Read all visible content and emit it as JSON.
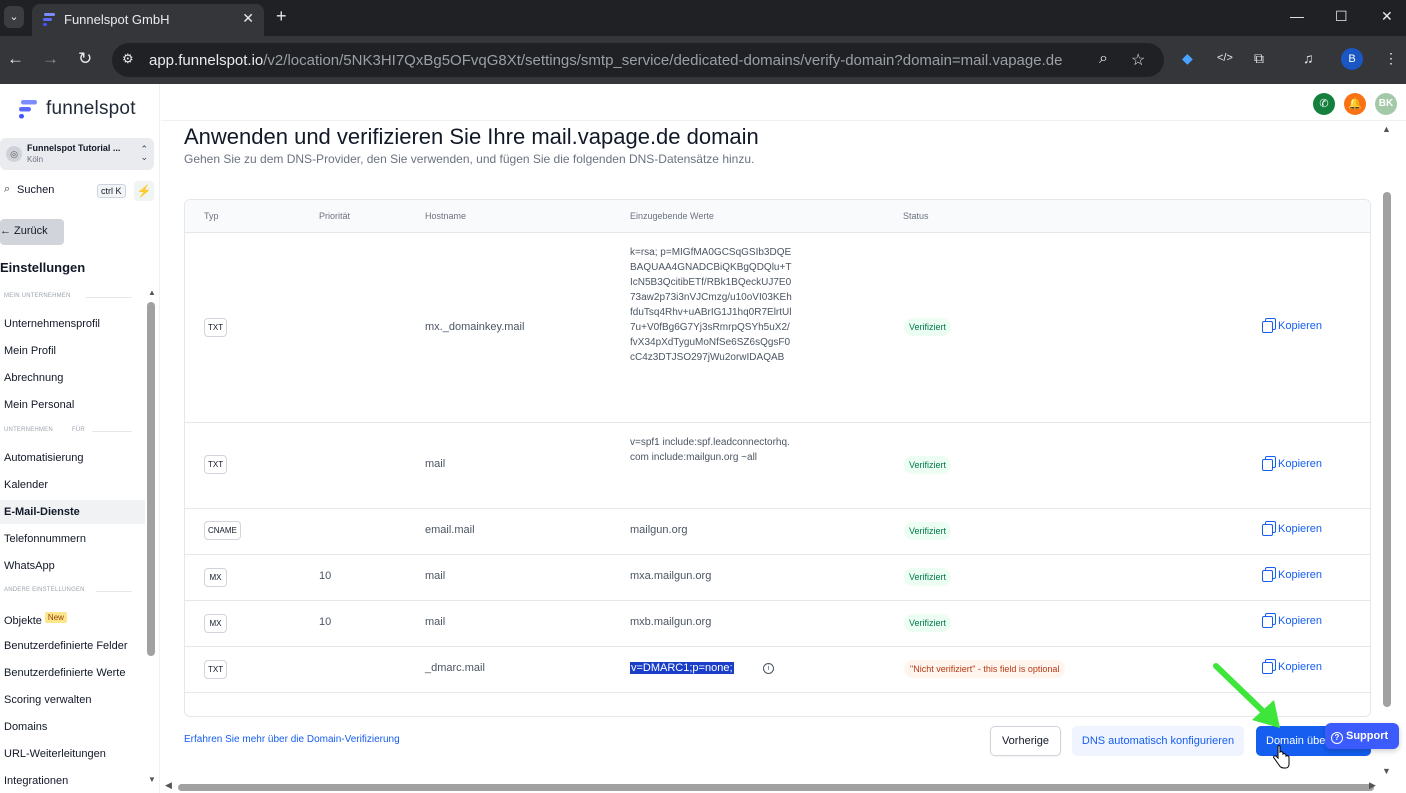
{
  "browser": {
    "tab_title": "Funnelspot GmbH",
    "url_host": "app.funnelspot.io",
    "url_path": "/v2/location/5NK3HI7QxBg5OFvqG8Xt/settings/smtp_service/dedicated-domains/verify-domain?domain=mail.vapage.de",
    "profile_initial": "B"
  },
  "sidebar": {
    "logo_text": "funnelspot",
    "location_name": "Funnelspot Tutorial ...",
    "location_city": "Köln",
    "search_label": "Suchen",
    "search_shortcut": "ctrl K",
    "back_label": "← Zurück",
    "section_title": "Einstellungen",
    "group1": "MEIN UNTERNEHMEN",
    "group2_a": "UNTERNEHMEN",
    "group2_b": "FÜR",
    "group3": "ANDERE EINSTELLUNGEN",
    "items": [
      "Unternehmensprofil",
      "Mein Profil",
      "Abrechnung",
      "Mein Personal",
      "Automatisierung",
      "Kalender",
      "E-Mail-Dienste",
      "Telefonnummern",
      "WhatsApp",
      "Objekte",
      "Benutzerdefinierte Felder",
      "Benutzerdefinierte Werte",
      "Scoring verwalten",
      "Domains",
      "URL-Weiterleitungen",
      "Integrationen"
    ],
    "new_badge": "New"
  },
  "appbar": {
    "avatar_initials": "BK",
    "colors": {
      "phone": "#15803d",
      "bell": "#f97316",
      "avatar": "#a3c9a8"
    }
  },
  "page": {
    "title": "Anwenden und verifizieren Sie Ihre mail.vapage.de domain",
    "description": "Gehen Sie zu dem DNS-Provider, den Sie verwenden, und fügen Sie die folgenden DNS-Datensätze hinzu."
  },
  "table": {
    "headers": {
      "type": "Typ",
      "priority": "Priorität",
      "hostname": "Hostname",
      "values": "Einzugebende Werte",
      "status": "Status"
    },
    "copy_label": "Kopieren",
    "rows": [
      {
        "type": "TXT",
        "priority": "",
        "hostname": "mx._domainkey.mail",
        "value": "k=rsa; p=MIGfMA0GCSqGSIb3DQEBAQUAA4GNADCBiQKBgQDQlu+TIcN5B3QcitibETf/RBk1BQeckUJ7E073aw2p73i3nVJCmzg/u10oVI03KEhfduTsq4Rhv+uABrIG1J1hq0R7ElrtUl7u+V0fBg6G7Yj3sRmrpQSYh5uX2/fvX34pXdTyguMoNfSe6SZ6sQgsF0cC4z3DTJSO297jWu2orwIDAQAB",
        "status": "Verifiziert"
      },
      {
        "type": "TXT",
        "priority": "",
        "hostname": "mail",
        "value": "v=spf1 include:spf.leadconnectorhq.com include:mailgun.org ~all",
        "status": "Verifiziert"
      },
      {
        "type": "CNAME",
        "priority": "",
        "hostname": "email.mail",
        "value": "mailgun.org",
        "status": "Verifiziert"
      },
      {
        "type": "MX",
        "priority": "10",
        "hostname": "mail",
        "value": "mxa.mailgun.org",
        "status": "Verifiziert"
      },
      {
        "type": "MX",
        "priority": "10",
        "hostname": "mail",
        "value": "mxb.mailgun.org",
        "status": "Verifiziert"
      },
      {
        "type": "TXT",
        "priority": "",
        "hostname": "_dmarc.mail",
        "value": "v=DMARC1;p=none;",
        "status": "\"Nicht verifiziert\" - this field is optional"
      }
    ]
  },
  "footer": {
    "learn_more": "Erfahren Sie mehr über die Domain-Verifizierung",
    "prev_label": "Vorherige",
    "auto_dns_label": "DNS automatisch konfigurieren",
    "verify_label": "Domain überprüfen",
    "support_label": "Support"
  }
}
